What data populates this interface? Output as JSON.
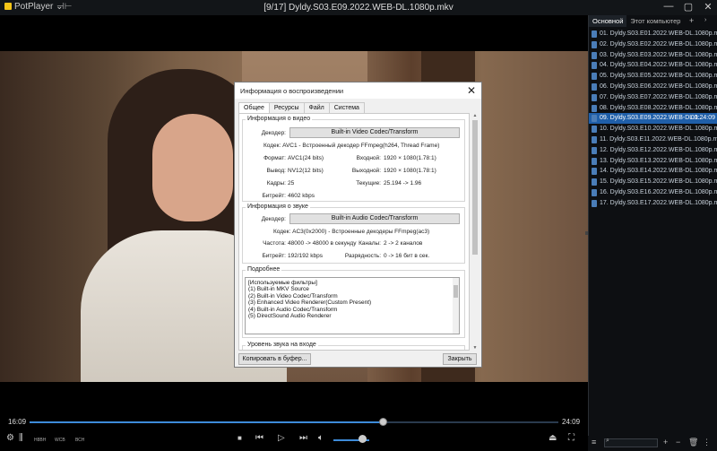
{
  "window": {
    "app_name": "PotPlayer",
    "title": "[9/17] Dyldy.S03.E09.2022.WEB-DL.1080p.mkv",
    "pin_icon": "pin-icon",
    "buttons": [
      "minimize-icon",
      "maximize-icon",
      "close-icon"
    ]
  },
  "dialog": {
    "title": "Информация о воспроизведении",
    "tabs": [
      "Общее",
      "Ресурсы",
      "Файл",
      "Система"
    ],
    "active_tab": "Общее",
    "video": {
      "group_title": "Информация о видео",
      "decoder_label": "Декодер:",
      "decoder_value": "Built-in Video Codec/Transform",
      "codec": "Кодек: AVC1 - Встроенный декодер FFmpeg(h264, Thread Frame)",
      "format_label": "Формат:",
      "format_value": "AVC1(24 bits)",
      "input_label": "Входной:",
      "input_value": "1920 × 1080(1.78:1)",
      "output_label": "Вывод:",
      "output_value": "NV12(12 bits)",
      "out_res_label": "Выходной:",
      "out_res_value": "1920 × 1080(1.78:1)",
      "frames_label": "Кадры:",
      "frames_value": "25",
      "current_label": "Текущие:",
      "current_value": "25.194 -> 1.96",
      "bitrate_label": "Битрейт:",
      "bitrate_value": "4602 kbps"
    },
    "audio": {
      "group_title": "Информация о звуке",
      "decoder_label": "Декодер:",
      "decoder_value": "Built-in Audio Codec/Transform",
      "codec": "Кодек: AC3(0x2000) - Встроенные декодеры FFmpeg(ac3)",
      "rate_label": "Частота:",
      "rate_value": "48000 -> 48000 в секунду",
      "channels_label": "Каналы:",
      "channels_value": "2 -> 2 каналов",
      "bitrate_label": "Битрейт:",
      "bitrate_value": "192/192 kbps",
      "depth_label": "Разрядность:",
      "depth_value": "0 -> 16 бит в сек."
    },
    "details": {
      "group_title": "Подробнее",
      "lines": [
        "[Используемые фильтры]",
        "(1) Built-in MKV Source",
        "(2) Built-in Video Codec/Transform",
        "(3) Enhanced Video Renderer(Custom Present)",
        "(4) Built-in Audio Codec/Transform",
        "(5) DirectSound Audio Renderer"
      ]
    },
    "level_title": "Уровень звука на входе",
    "copy_button": "Копировать в буфер...",
    "close_button": "Закрыть"
  },
  "playlist": {
    "tabs": [
      "Основной",
      "Этот компьютер"
    ],
    "active_tab": "Основной",
    "add_tab": "+",
    "items": [
      "01. Dyldy.S03.E01.2022.WEB-DL.1080p.mkv",
      "02. Dyldy.S03.E02.2022.WEB-DL.1080p.mkv",
      "03. Dyldy.S03.E03.2022.WEB-DL.1080p.mkv",
      "04. Dyldy.S03.E04.2022.WEB-DL.1080p.mkv",
      "05. Dyldy.S03.E05.2022.WEB-DL.1080p.mkv",
      "06. Dyldy.S03.E06.2022.WEB-DL.1080p.mkv",
      "07. Dyldy.S03.E07.2022.WEB-DL.1080p.mkv",
      "08. Dyldy.S03.E08.2022.WEB-DL.1080p.mkv",
      "09. Dyldy.S03.E09.2022.WEB-DL.1...",
      "10. Dyldy.S03.E10.2022.WEB-DL.1080p.mkv",
      "11. Dyldy.S03.E11.2022.WEB-DL.1080p.mkv",
      "12. Dyldy.S03.E12.2022.WEB-DL.1080p.mkv",
      "13. Dyldy.S03.E13.2022.WEB-DL.1080p.mkv",
      "14. Dyldy.S03.E14.2022.WEB-DL.1080p.mkv",
      "15. Dyldy.S03.E15.2022.WEB-DL.1080p.mkv",
      "16. Dyldy.S03.E16.2022.WEB-DL.1080p.mkv",
      "17. Dyldy.S03.E17.2022.WEB-DL.1080p.mkv"
    ],
    "selected_index": 8,
    "selected_duration": "00:24:09"
  },
  "player": {
    "elapsed": "16:09",
    "total": "24:09",
    "progress": 0.668,
    "volume": 0.8,
    "small_labels": [
      "H8BH",
      "WCB",
      "ВСН"
    ],
    "accent_color": "#3d8bd9"
  }
}
